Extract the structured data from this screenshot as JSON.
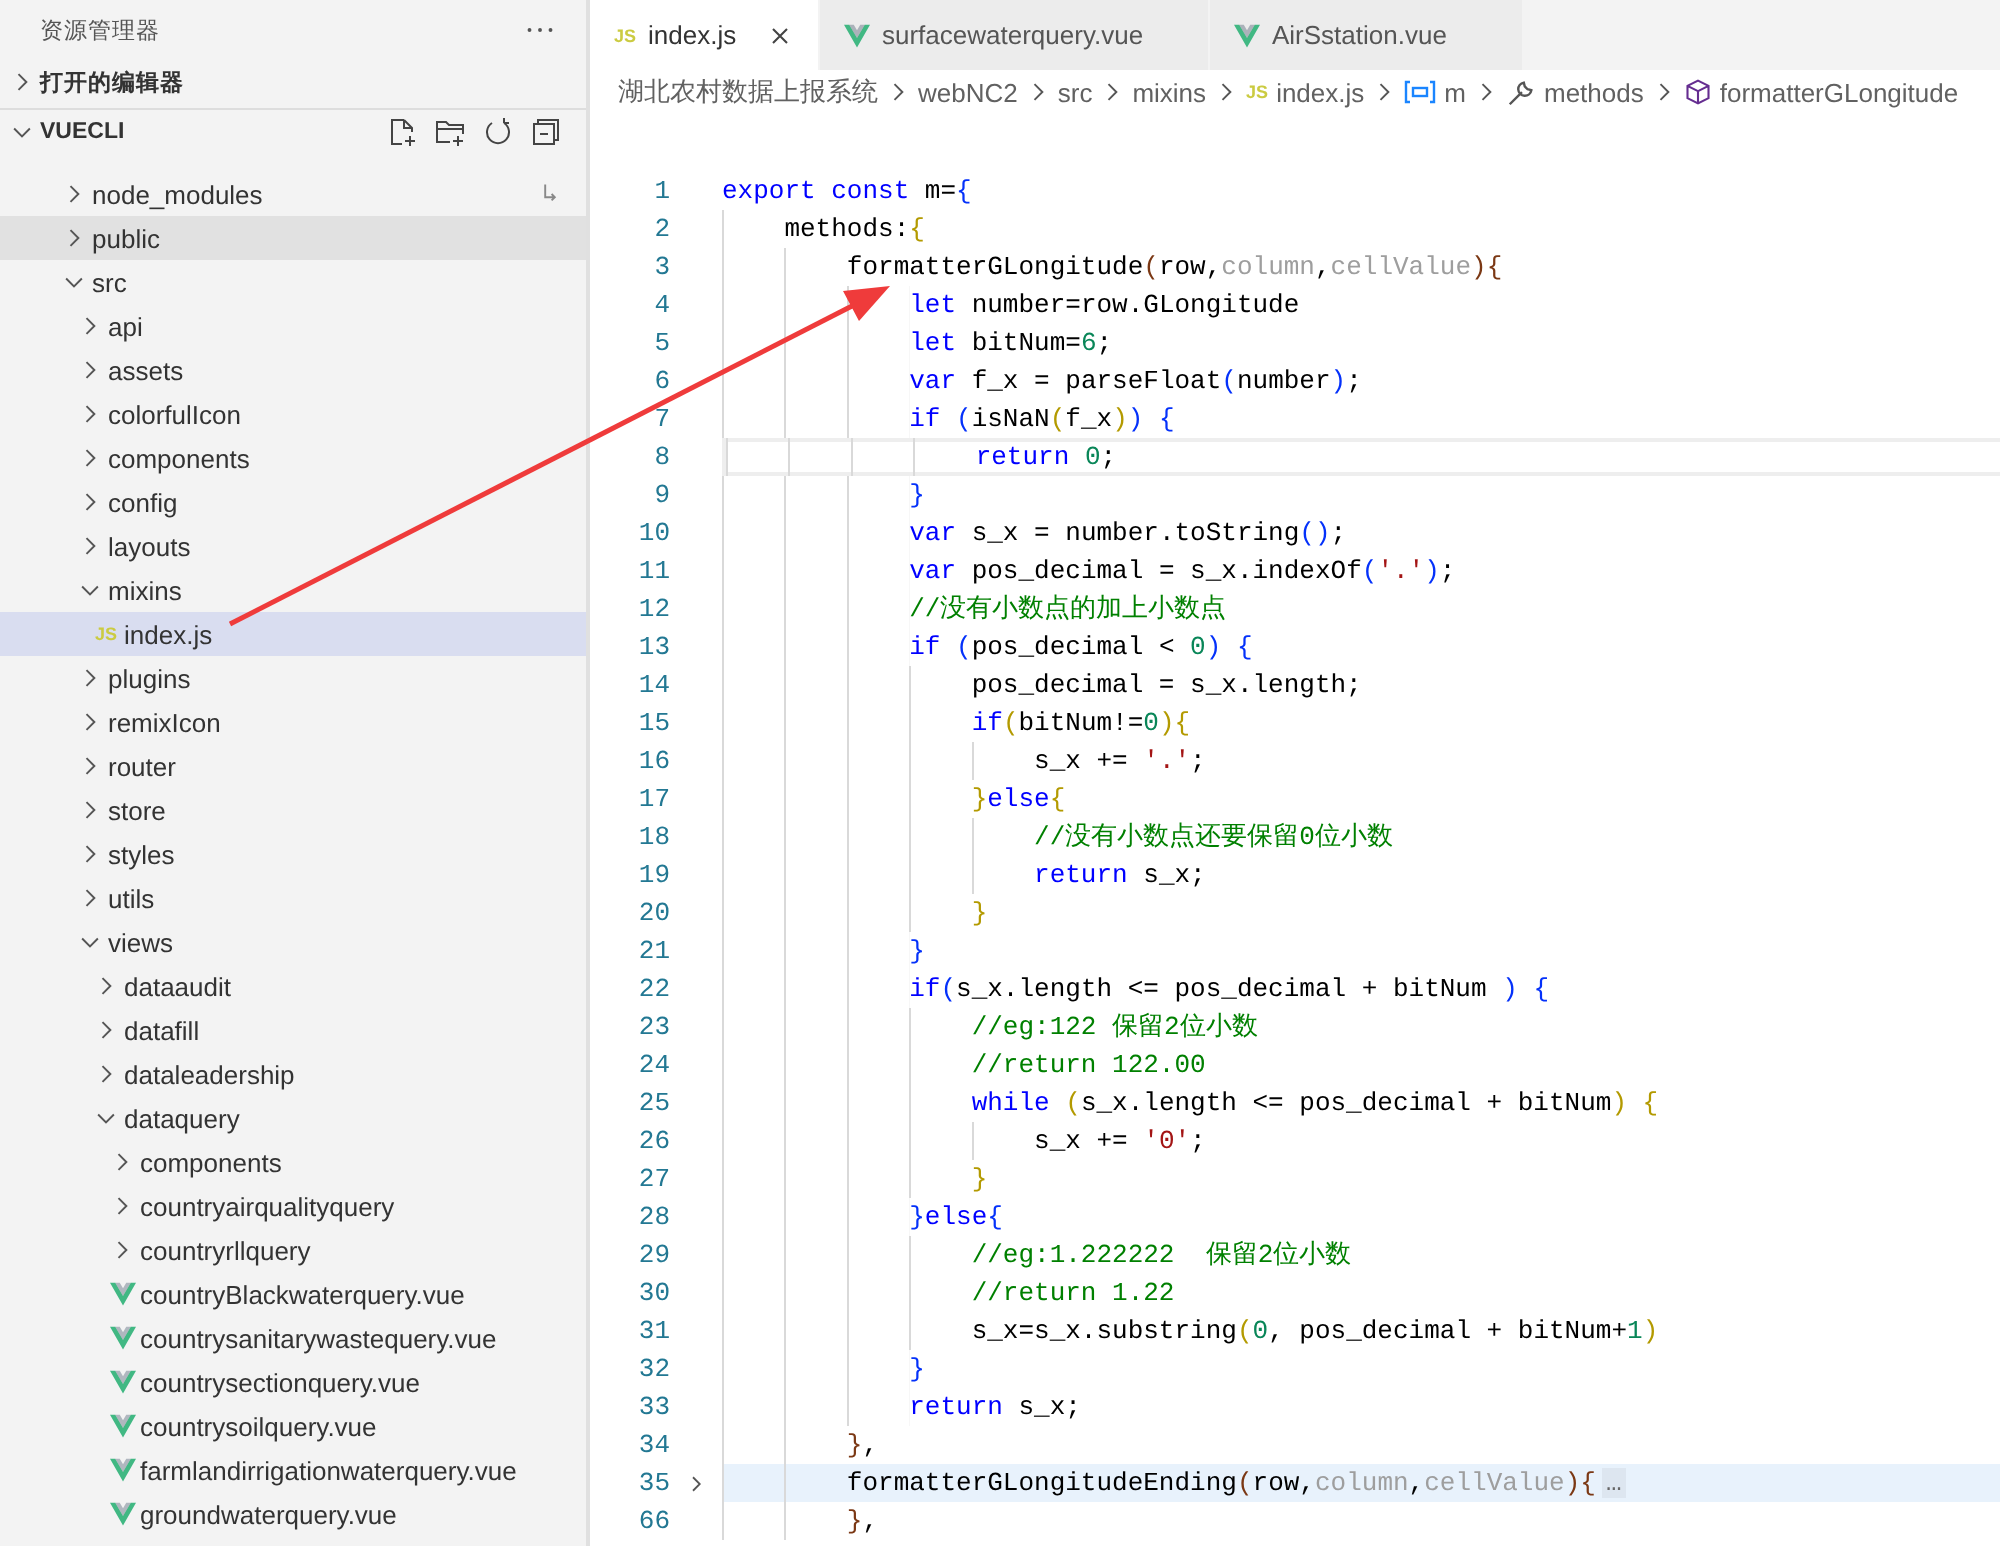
{
  "explorer": {
    "title": "资源管理器",
    "sections": [
      {
        "label": "打开的编辑器",
        "expanded": false,
        "toolbar": false
      },
      {
        "label": "VUECLI",
        "expanded": true,
        "toolbar": true
      }
    ],
    "tree": [
      {
        "label": "node_modules",
        "kind": "folder",
        "expanded": false,
        "selected": false,
        "hovered": false,
        "linked": true
      },
      {
        "label": "public",
        "kind": "folder",
        "expanded": false,
        "selected": false,
        "hovered": true
      },
      {
        "label": "src",
        "kind": "folder",
        "expanded": true,
        "selected": false,
        "hovered": false,
        "children": [
          {
            "label": "api",
            "kind": "folder",
            "expanded": false,
            "selected": false,
            "hovered": false
          },
          {
            "label": "assets",
            "kind": "folder",
            "expanded": false,
            "selected": false,
            "hovered": false
          },
          {
            "label": "colorfulIcon",
            "kind": "folder",
            "expanded": false,
            "selected": false,
            "hovered": false
          },
          {
            "label": "components",
            "kind": "folder",
            "expanded": false,
            "selected": false,
            "hovered": false
          },
          {
            "label": "config",
            "kind": "folder",
            "expanded": false,
            "selected": false,
            "hovered": false
          },
          {
            "label": "layouts",
            "kind": "folder",
            "expanded": false,
            "selected": false,
            "hovered": false
          },
          {
            "label": "mixins",
            "kind": "folder",
            "expanded": true,
            "selected": false,
            "hovered": false,
            "children": [
              {
                "label": "index.js",
                "kind": "js",
                "icon_label": "JS",
                "selected": true,
                "hovered": false
              }
            ]
          },
          {
            "label": "plugins",
            "kind": "folder",
            "expanded": false,
            "selected": false,
            "hovered": false
          },
          {
            "label": "remixIcon",
            "kind": "folder",
            "expanded": false,
            "selected": false,
            "hovered": false
          },
          {
            "label": "router",
            "kind": "folder",
            "expanded": false,
            "selected": false,
            "hovered": false
          },
          {
            "label": "store",
            "kind": "folder",
            "expanded": false,
            "selected": false,
            "hovered": false
          },
          {
            "label": "styles",
            "kind": "folder",
            "expanded": false,
            "selected": false,
            "hovered": false
          },
          {
            "label": "utils",
            "kind": "folder",
            "expanded": false,
            "selected": false,
            "hovered": false
          },
          {
            "label": "views",
            "kind": "folder",
            "expanded": true,
            "selected": false,
            "hovered": false,
            "children": [
              {
                "label": "dataaudit",
                "kind": "folder",
                "expanded": false,
                "selected": false,
                "hovered": false
              },
              {
                "label": "datafill",
                "kind": "folder",
                "expanded": false,
                "selected": false,
                "hovered": false
              },
              {
                "label": "dataleadership",
                "kind": "folder",
                "expanded": false,
                "selected": false,
                "hovered": false
              },
              {
                "label": "dataquery",
                "kind": "folder",
                "expanded": true,
                "selected": false,
                "hovered": false,
                "children": [
                  {
                    "label": "components",
                    "kind": "folder",
                    "expanded": false,
                    "selected": false,
                    "hovered": false
                  },
                  {
                    "label": "countryairqualityquery",
                    "kind": "folder",
                    "expanded": false,
                    "selected": false,
                    "hovered": false
                  },
                  {
                    "label": "countryrllquery",
                    "kind": "folder",
                    "expanded": false,
                    "selected": false,
                    "hovered": false
                  },
                  {
                    "label": "countryBlackwaterquery.vue",
                    "kind": "vue",
                    "selected": false,
                    "hovered": false
                  },
                  {
                    "label": "countrysanitarywastequery.vue",
                    "kind": "vue",
                    "selected": false,
                    "hovered": false
                  },
                  {
                    "label": "countrysectionquery.vue",
                    "kind": "vue",
                    "selected": false,
                    "hovered": false
                  },
                  {
                    "label": "countrysoilquery.vue",
                    "kind": "vue",
                    "selected": false,
                    "hovered": false
                  },
                  {
                    "label": "farmlandirrigationwaterquery.vue",
                    "kind": "vue",
                    "selected": false,
                    "hovered": false
                  },
                  {
                    "label": "groundwaterquery.vue",
                    "kind": "vue",
                    "selected": false,
                    "hovered": false
                  }
                ]
              }
            ]
          }
        ]
      }
    ]
  },
  "tabs": [
    {
      "label": "index.js",
      "kind": "js",
      "icon_label": "JS",
      "selected": true
    },
    {
      "label": "surfacewaterquery.vue",
      "kind": "vue",
      "selected": false
    },
    {
      "label": "AirSstation.vue",
      "kind": "vue",
      "selected": false
    }
  ],
  "breadcrumbs": [
    {
      "label": "湖北农村数据上报系统",
      "kind": "folder"
    },
    {
      "label": "webNC2",
      "kind": "folder"
    },
    {
      "label": "src",
      "kind": "folder"
    },
    {
      "label": "mixins",
      "kind": "folder"
    },
    {
      "label": "index.js",
      "kind": "js",
      "icon_label": "JS"
    },
    {
      "label": "m",
      "kind": "variable"
    },
    {
      "label": "methods",
      "kind": "method"
    },
    {
      "label": "formatterGLongitude",
      "kind": "function"
    }
  ],
  "code": [
    {
      "number": "1",
      "current": false,
      "folded": false,
      "tokens": [
        {
          "kind": "kw",
          "text": "export"
        },
        {
          "kind": "kw",
          "text": " const"
        },
        {
          "kind": "plain",
          "text": " m="
        },
        {
          "kind": "b1",
          "text": "{"
        }
      ]
    },
    {
      "number": "2",
      "current": false,
      "folded": false,
      "tokens": [
        {
          "kind": "plain",
          "text": "    methods:"
        },
        {
          "kind": "b2",
          "text": "{"
        }
      ]
    },
    {
      "number": "3",
      "current": false,
      "folded": false,
      "tokens": [
        {
          "kind": "plain",
          "text": "        formatterGLongitude"
        },
        {
          "kind": "b3",
          "text": "("
        },
        {
          "kind": "plain",
          "text": "row,"
        },
        {
          "kind": "dim",
          "text": "column"
        },
        {
          "kind": "plain",
          "text": ","
        },
        {
          "kind": "dim",
          "text": "cellValue"
        },
        {
          "kind": "b3",
          "text": "){"
        }
      ]
    },
    {
      "number": "4",
      "current": false,
      "folded": false,
      "tokens": [
        {
          "kind": "kw",
          "text": "            let"
        },
        {
          "kind": "plain",
          "text": " number=row.GLongitude"
        }
      ]
    },
    {
      "number": "5",
      "current": false,
      "folded": false,
      "tokens": [
        {
          "kind": "kw",
          "text": "            let"
        },
        {
          "kind": "plain",
          "text": " bitNum="
        },
        {
          "kind": "num",
          "text": "6"
        },
        {
          "kind": "plain",
          "text": ";"
        }
      ]
    },
    {
      "number": "6",
      "current": false,
      "folded": false,
      "tokens": [
        {
          "kind": "kw",
          "text": "            var"
        },
        {
          "kind": "plain",
          "text": " f_x = parseFloat"
        },
        {
          "kind": "b1",
          "text": "("
        },
        {
          "kind": "plain",
          "text": "number"
        },
        {
          "kind": "b1",
          "text": ")"
        },
        {
          "kind": "plain",
          "text": ";"
        }
      ]
    },
    {
      "number": "7",
      "current": false,
      "folded": false,
      "tokens": [
        {
          "kind": "kw",
          "text": "            if"
        },
        {
          "kind": "b1",
          "text": " ("
        },
        {
          "kind": "plain",
          "text": "isNaN"
        },
        {
          "kind": "b2",
          "text": "("
        },
        {
          "kind": "plain",
          "text": "f_x"
        },
        {
          "kind": "b2",
          "text": ")"
        },
        {
          "kind": "b1",
          "text": ")"
        },
        {
          "kind": "b1",
          "text": " {"
        }
      ]
    },
    {
      "number": "8",
      "current": true,
      "folded": false,
      "tokens": [
        {
          "kind": "kw",
          "text": "                return"
        },
        {
          "kind": "num",
          "text": " 0"
        },
        {
          "kind": "plain",
          "text": ";"
        }
      ]
    },
    {
      "number": "9",
      "current": false,
      "folded": false,
      "tokens": [
        {
          "kind": "b1",
          "text": "            }"
        }
      ]
    },
    {
      "number": "10",
      "current": false,
      "folded": false,
      "tokens": [
        {
          "kind": "kw",
          "text": "            var"
        },
        {
          "kind": "plain",
          "text": " s_x = number.toString"
        },
        {
          "kind": "b1",
          "text": "()"
        },
        {
          "kind": "plain",
          "text": ";"
        }
      ]
    },
    {
      "number": "11",
      "current": false,
      "folded": false,
      "tokens": [
        {
          "kind": "kw",
          "text": "            var"
        },
        {
          "kind": "plain",
          "text": " pos_decimal = s_x.indexOf"
        },
        {
          "kind": "b1",
          "text": "("
        },
        {
          "kind": "str",
          "text": "'.'"
        },
        {
          "kind": "b1",
          "text": ")"
        },
        {
          "kind": "plain",
          "text": ";"
        }
      ]
    },
    {
      "number": "12",
      "current": false,
      "folded": false,
      "tokens": [
        {
          "kind": "comment",
          "text": "            //没有小数点的加上小数点"
        }
      ]
    },
    {
      "number": "13",
      "current": false,
      "folded": false,
      "tokens": [
        {
          "kind": "kw",
          "text": "            if"
        },
        {
          "kind": "b1",
          "text": " ("
        },
        {
          "kind": "plain",
          "text": "pos_decimal < "
        },
        {
          "kind": "num",
          "text": "0"
        },
        {
          "kind": "b1",
          "text": ")"
        },
        {
          "kind": "b1",
          "text": " {"
        }
      ]
    },
    {
      "number": "14",
      "current": false,
      "folded": false,
      "tokens": [
        {
          "kind": "plain",
          "text": "                pos_decimal = s_x.length;"
        }
      ]
    },
    {
      "number": "15",
      "current": false,
      "folded": false,
      "tokens": [
        {
          "kind": "kw",
          "text": "                if"
        },
        {
          "kind": "b2",
          "text": "("
        },
        {
          "kind": "plain",
          "text": "bitNum!="
        },
        {
          "kind": "num",
          "text": "0"
        },
        {
          "kind": "b2",
          "text": "){"
        }
      ]
    },
    {
      "number": "16",
      "current": false,
      "folded": false,
      "tokens": [
        {
          "kind": "plain",
          "text": "                    s_x += "
        },
        {
          "kind": "str",
          "text": "'.'"
        },
        {
          "kind": "plain",
          "text": ";"
        }
      ]
    },
    {
      "number": "17",
      "current": false,
      "folded": false,
      "tokens": [
        {
          "kind": "b2",
          "text": "                }"
        },
        {
          "kind": "kw",
          "text": "else"
        },
        {
          "kind": "b2",
          "text": "{"
        }
      ]
    },
    {
      "number": "18",
      "current": false,
      "folded": false,
      "tokens": [
        {
          "kind": "comment",
          "text": "                    //没有小数点还要保留0位小数"
        }
      ]
    },
    {
      "number": "19",
      "current": false,
      "folded": false,
      "tokens": [
        {
          "kind": "kw",
          "text": "                    return"
        },
        {
          "kind": "plain",
          "text": " s_x;"
        }
      ]
    },
    {
      "number": "20",
      "current": false,
      "folded": false,
      "tokens": [
        {
          "kind": "b2",
          "text": "                }"
        }
      ]
    },
    {
      "number": "21",
      "current": false,
      "folded": false,
      "tokens": [
        {
          "kind": "b1",
          "text": "            }"
        }
      ]
    },
    {
      "number": "22",
      "current": false,
      "folded": false,
      "tokens": [
        {
          "kind": "kw",
          "text": "            if"
        },
        {
          "kind": "b1",
          "text": "("
        },
        {
          "kind": "plain",
          "text": "s_x.length <= pos_decimal + bitNum "
        },
        {
          "kind": "b1",
          "text": ")"
        },
        {
          "kind": "b1",
          "text": " {"
        }
      ]
    },
    {
      "number": "23",
      "current": false,
      "folded": false,
      "tokens": [
        {
          "kind": "comment",
          "text": "                //eg:122 保留2位小数"
        }
      ]
    },
    {
      "number": "24",
      "current": false,
      "folded": false,
      "tokens": [
        {
          "kind": "comment",
          "text": "                //return 122.00"
        }
      ]
    },
    {
      "number": "25",
      "current": false,
      "folded": false,
      "tokens": [
        {
          "kind": "kw",
          "text": "                while"
        },
        {
          "kind": "b2",
          "text": " ("
        },
        {
          "kind": "plain",
          "text": "s_x.length <= pos_decimal + bitNum"
        },
        {
          "kind": "b2",
          "text": ")"
        },
        {
          "kind": "b2",
          "text": " {"
        }
      ]
    },
    {
      "number": "26",
      "current": false,
      "folded": false,
      "tokens": [
        {
          "kind": "plain",
          "text": "                    s_x += "
        },
        {
          "kind": "str",
          "text": "'0'"
        },
        {
          "kind": "plain",
          "text": ";"
        }
      ]
    },
    {
      "number": "27",
      "current": false,
      "folded": false,
      "tokens": [
        {
          "kind": "b2",
          "text": "                }"
        }
      ]
    },
    {
      "number": "28",
      "current": false,
      "folded": false,
      "tokens": [
        {
          "kind": "b1",
          "text": "            }"
        },
        {
          "kind": "kw",
          "text": "else"
        },
        {
          "kind": "b1",
          "text": "{"
        }
      ]
    },
    {
      "number": "29",
      "current": false,
      "folded": false,
      "tokens": [
        {
          "kind": "comment",
          "text": "                //eg:1.222222  保留2位小数"
        }
      ]
    },
    {
      "number": "30",
      "current": false,
      "folded": false,
      "tokens": [
        {
          "kind": "comment",
          "text": "                //return 1.22"
        }
      ]
    },
    {
      "number": "31",
      "current": false,
      "folded": false,
      "tokens": [
        {
          "kind": "plain",
          "text": "                s_x=s_x.substring"
        },
        {
          "kind": "b2",
          "text": "("
        },
        {
          "kind": "num",
          "text": "0"
        },
        {
          "kind": "plain",
          "text": ", pos_decimal + bitNum+"
        },
        {
          "kind": "num",
          "text": "1"
        },
        {
          "kind": "b2",
          "text": ")"
        }
      ]
    },
    {
      "number": "32",
      "current": false,
      "folded": false,
      "tokens": [
        {
          "kind": "b1",
          "text": "            }"
        }
      ]
    },
    {
      "number": "33",
      "current": false,
      "folded": false,
      "tokens": [
        {
          "kind": "kw",
          "text": "            return"
        },
        {
          "kind": "plain",
          "text": " s_x;"
        }
      ]
    },
    {
      "number": "34",
      "current": false,
      "folded": false,
      "tokens": [
        {
          "kind": "b3",
          "text": "        }"
        },
        {
          "kind": "plain",
          "text": ","
        }
      ]
    },
    {
      "number": "35",
      "current": false,
      "folded": true,
      "tokens": [
        {
          "kind": "plain",
          "text": "        formatterGLongitudeEnding"
        },
        {
          "kind": "b3",
          "text": "("
        },
        {
          "kind": "plain",
          "text": "row,"
        },
        {
          "kind": "dim",
          "text": "column"
        },
        {
          "kind": "plain",
          "text": ","
        },
        {
          "kind": "dim",
          "text": "cellValue"
        },
        {
          "kind": "b3",
          "text": "){"
        },
        {
          "kind": "fold",
          "text": "…"
        }
      ]
    },
    {
      "number": "66",
      "current": false,
      "folded": false,
      "tokens": [
        {
          "kind": "b3",
          "text": "        }"
        },
        {
          "kind": "plain",
          "text": ","
        }
      ]
    }
  ]
}
